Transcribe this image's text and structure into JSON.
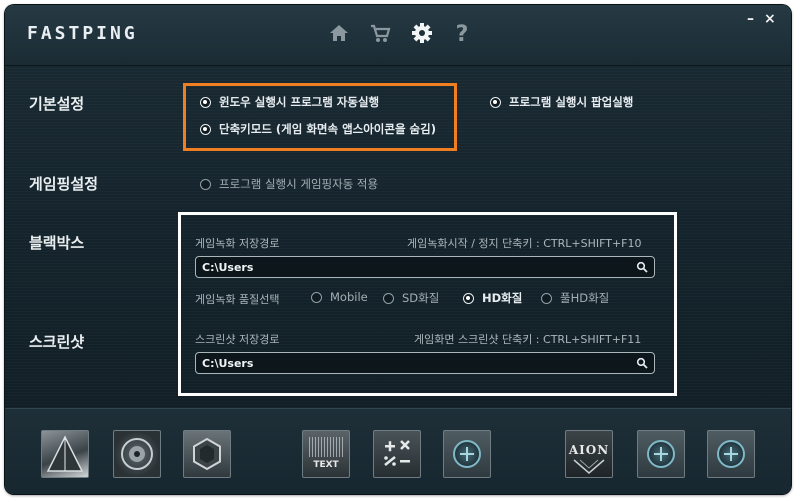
{
  "app": {
    "logo": "FASTPING"
  },
  "nav": [
    {
      "name": "home-icon",
      "glyph": "⌂"
    },
    {
      "name": "cart-icon",
      "glyph": "🛒"
    },
    {
      "name": "gear-icon",
      "glyph": "⚙"
    },
    {
      "name": "help-icon",
      "glyph": "?"
    }
  ],
  "window_controls": {
    "minimize": "–",
    "close": "×"
  },
  "basic": {
    "label": "기본설정",
    "opt_autostart": "윈도우 실행시 프로그램 자동실행",
    "opt_popup": "프로그램 실행시 팝업실행",
    "opt_hotkey": "단축키모드 (게임 화면속 앱스아이콘을 숨김)"
  },
  "gameping": {
    "label": "게임핑설정",
    "opt_auto": "프로그램 실행시 게임핑자동 적용"
  },
  "blackbox": {
    "label": "블랙박스",
    "path_label": "게임녹화 저장경로",
    "hotkey_info": "게임녹화시작 / 정지 단축키 : CTRL+SHIFT+F10",
    "path_value": "C:\\Users",
    "quality_label": "게임녹화 품질선택",
    "quality_options": [
      "Mobile",
      "SD화질",
      "HD화질",
      "풀HD화질"
    ],
    "quality_selected": "HD화질"
  },
  "screenshot": {
    "label": "스크린샷",
    "path_label": "스크린샷 저장경로",
    "hotkey_info": "게임화면 스크린샷 단축키 : CTRL+SHIFT+F11",
    "path_value": "C:\\Users"
  },
  "tiles": {
    "text_tile_label": "TEXT",
    "calc_tile_label": "+×\n⁒−",
    "aion_label": "AION"
  },
  "colors": {
    "highlight_orange": "#f07f22",
    "highlight_white": "#ffffff",
    "window_bg": "#14232b"
  }
}
